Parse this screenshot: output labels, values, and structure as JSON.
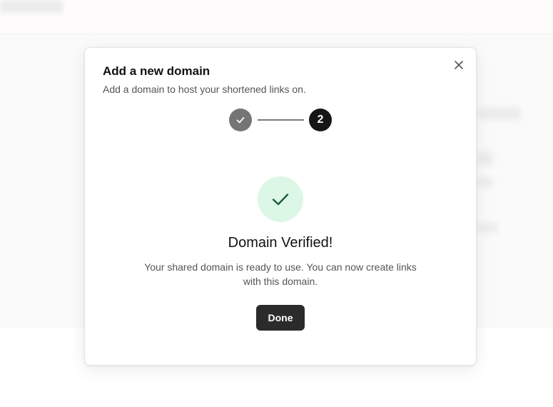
{
  "modal": {
    "title": "Add a new domain",
    "subtitle": "Add a domain to host your shortened links on.",
    "close_icon": "close-icon"
  },
  "stepper": {
    "steps": [
      {
        "state": "completed",
        "icon": "check-icon"
      },
      {
        "state": "active",
        "label": "2"
      }
    ]
  },
  "success": {
    "icon": "check-icon",
    "title": "Domain Verified!",
    "description": "Your shared domain is ready to use. You can now create links with this domain."
  },
  "actions": {
    "done_label": "Done"
  },
  "colors": {
    "success_bg": "#dcf7e6",
    "success_check": "#1f5c36",
    "step_done": "#757575",
    "step_active": "#161616",
    "button_bg": "#2b2b2b"
  }
}
